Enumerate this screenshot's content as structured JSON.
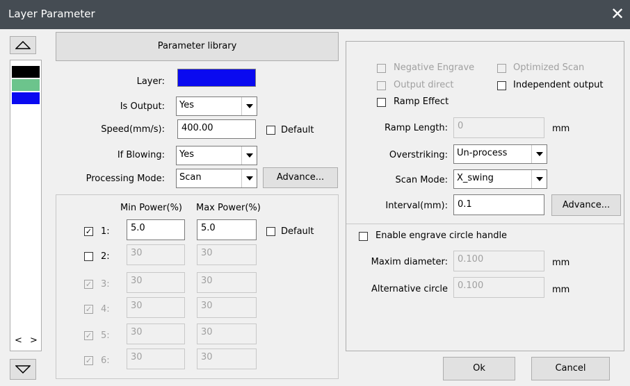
{
  "window": {
    "title": "Layer Parameter"
  },
  "layer_list": {
    "colors": [
      "#000000",
      "#6cc48c",
      "#0a0af0"
    ],
    "scroll_left": "<",
    "scroll_right": ">"
  },
  "left": {
    "parameter_library": "Parameter library",
    "layer_label": "Layer:",
    "layer_color": "#0a0af0",
    "is_output_label": "Is Output:",
    "is_output_value": "Yes",
    "speed_label": "Speed(mm/s):",
    "speed_value": "400.00",
    "speed_default_label": "Default",
    "if_blowing_label": "If Blowing:",
    "if_blowing_value": "Yes",
    "processing_mode_label": "Processing Mode:",
    "processing_mode_value": "Scan",
    "advance_button": "Advance..."
  },
  "power": {
    "min_header": "Min Power(%)",
    "max_header": "Max Power(%)",
    "default_label": "Default",
    "rows": [
      {
        "label": "1:",
        "checked": true,
        "enabled": true,
        "min": "5.0",
        "max": "5.0"
      },
      {
        "label": "2:",
        "checked": false,
        "enabled": true,
        "min": "30",
        "max": "30"
      },
      {
        "label": "3:",
        "checked": true,
        "enabled": false,
        "min": "30",
        "max": "30"
      },
      {
        "label": "4:",
        "checked": true,
        "enabled": false,
        "min": "30",
        "max": "30"
      },
      {
        "label": "5:",
        "checked": true,
        "enabled": false,
        "min": "30",
        "max": "30"
      },
      {
        "label": "6:",
        "checked": true,
        "enabled": false,
        "min": "30",
        "max": "30"
      }
    ]
  },
  "right": {
    "negative_engrave": "Negative Engrave",
    "optimized_scan": "Optimized Scan",
    "output_direct": "Output direct",
    "independent_output": "Independent output",
    "ramp_effect": "Ramp Effect",
    "ramp_length_label": "Ramp Length:",
    "ramp_length_value": "0",
    "ramp_length_unit": "mm",
    "overstriking_label": "Overstriking:",
    "overstriking_value": "Un-process",
    "scan_mode_label": "Scan Mode:",
    "scan_mode_value": "X_swing",
    "interval_label": "Interval(mm):",
    "interval_value": "0.1",
    "advance_button": "Advance...",
    "enable_circle": "Enable engrave circle handle",
    "maxim_diameter_label": "Maxim diameter:",
    "maxim_diameter_value": "0.100",
    "maxim_diameter_unit": "mm",
    "alt_circle_label": "Alternative circle",
    "alt_circle_value": "0.100",
    "alt_circle_unit": "mm"
  },
  "footer": {
    "ok": "Ok",
    "cancel": "Cancel"
  }
}
